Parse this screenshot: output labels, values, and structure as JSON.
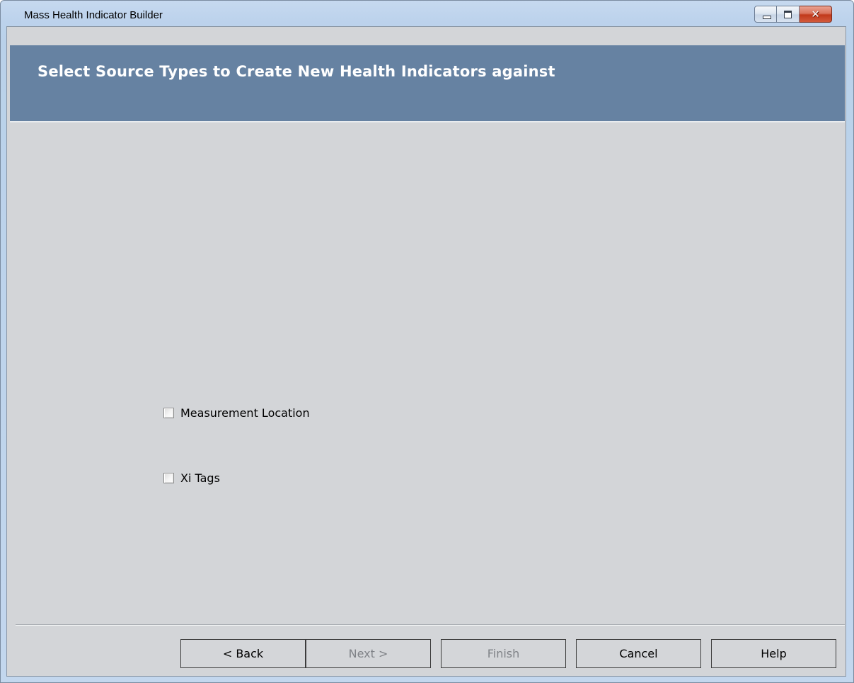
{
  "window": {
    "title": "Mass Health Indicator Builder",
    "caption_buttons": {
      "minimize_icon": "minimize-icon",
      "maximize_icon": "maximize-icon",
      "close_icon": "close-icon",
      "close_glyph": "✕"
    }
  },
  "header": {
    "title": "Select Source Types to Create New Health Indicators against",
    "background_color": "#6682a2"
  },
  "options": [
    {
      "label": "Measurement Location",
      "checked": false
    },
    {
      "label": "Xi Tags",
      "checked": false
    }
  ],
  "footer": {
    "buttons": [
      {
        "label": "< Back",
        "enabled": true
      },
      {
        "label": "Next >",
        "enabled": false
      },
      {
        "label": "Finish",
        "enabled": false
      },
      {
        "label": "Cancel",
        "enabled": true
      },
      {
        "label": "Help",
        "enabled": true
      }
    ]
  }
}
